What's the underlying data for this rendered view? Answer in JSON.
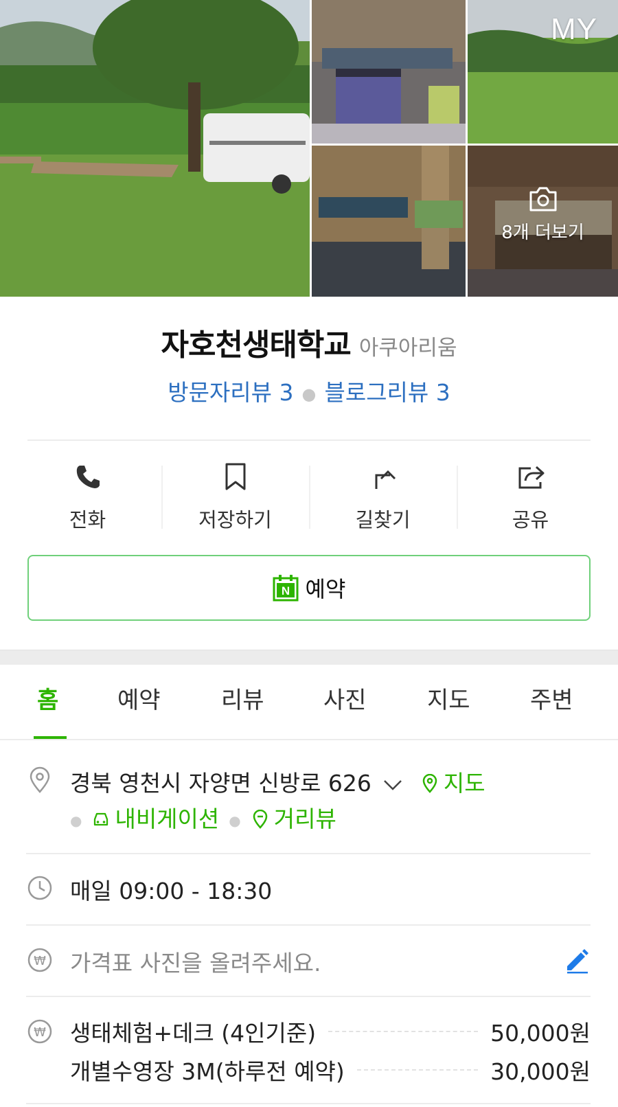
{
  "photos": {
    "my_badge": "MY",
    "more_label": "8개 더보기"
  },
  "place": {
    "name": "자호천생태학교",
    "category": "아쿠아리움",
    "visitor_reviews": "방문자리뷰 3",
    "blog_reviews": "블로그리뷰 3"
  },
  "actions": [
    {
      "label": "전화",
      "icon": "phone-icon"
    },
    {
      "label": "저장하기",
      "icon": "bookmark-icon"
    },
    {
      "label": "길찾기",
      "icon": "directions-icon"
    },
    {
      "label": "공유",
      "icon": "share-icon"
    }
  ],
  "booking": {
    "label": "예약",
    "icon": "naver-booking-icon"
  },
  "tabs": [
    {
      "label": "홈",
      "active": true
    },
    {
      "label": "예약",
      "active": false
    },
    {
      "label": "리뷰",
      "active": false
    },
    {
      "label": "사진",
      "active": false
    },
    {
      "label": "지도",
      "active": false
    },
    {
      "label": "주변",
      "active": false
    }
  ],
  "info": {
    "address": "경북 영천시 자양면 신방로 626",
    "map_link": "지도",
    "navigation_link": "내비게이션",
    "street_view_link": "거리뷰",
    "hours": "매일 09:00 - 18:30",
    "price_photo_prompt": "가격표 사진을 올려주세요.",
    "prices": [
      {
        "name": "생태체험+데크 (4인기준)",
        "value": "50,000원"
      },
      {
        "name": "개별수영장 3M(하루전 예약)",
        "value": "30,000원"
      }
    ]
  },
  "colors": {
    "accent_green": "#2db400",
    "review_blue": "#2c6fc0",
    "edit_blue": "#1e7be8"
  }
}
